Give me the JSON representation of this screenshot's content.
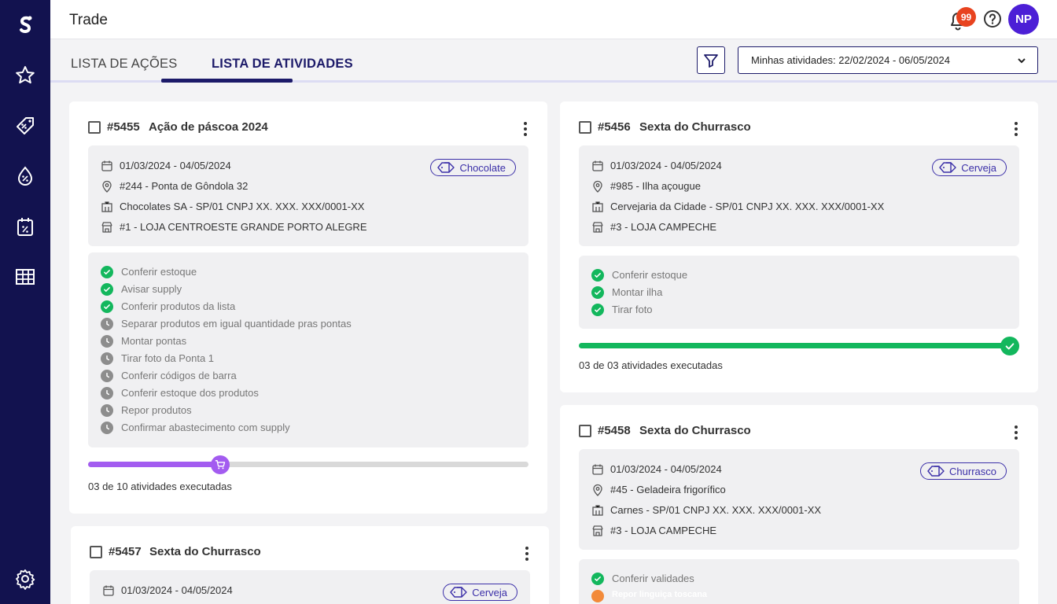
{
  "app": {
    "title": "Trade"
  },
  "header": {
    "notifications_count": "99",
    "avatar_initials": "NP"
  },
  "sidebar": {
    "icons": [
      "logo-icon",
      "star-icon",
      "tag-discount-icon",
      "drop-percent-icon",
      "calendar-percent-icon",
      "table-icon",
      "gear-icon"
    ]
  },
  "tabs": [
    {
      "label": "LISTA DE AÇÕES",
      "active": false
    },
    {
      "label": "LISTA DE ATIVIDADES",
      "active": true
    }
  ],
  "filter": {
    "date_range_label": "Minhas atividades: 22/02/2024 - 06/05/2024"
  },
  "colors": {
    "primary": "#1c1a69",
    "sidebar": "#12124f",
    "done": "#13b75d",
    "progress_purple": "#a35cf0",
    "warning": "#f28a3a",
    "badge": "#e8431f"
  },
  "cards": [
    {
      "id": "#5455",
      "name": "Ação de páscoa 2024",
      "tag": "Chocolate",
      "dates": "01/03/2024 - 04/05/2024",
      "location": "#244 - Ponta de Gôndola 32",
      "company": "Chocolates SA - SP/01 CNPJ XX. XXX. XXX/0001-XX",
      "store": "#1 - LOJA CENTROESTE GRANDE PORTO ALEGRE",
      "activities": [
        {
          "label": "Conferir estoque",
          "status": "done"
        },
        {
          "label": "Avisar supply",
          "status": "done"
        },
        {
          "label": "Conferir produtos da lista",
          "status": "done"
        },
        {
          "label": "Separar produtos em igual quantidade pras pontas",
          "status": "pending"
        },
        {
          "label": "Montar pontas",
          "status": "pending"
        },
        {
          "label": "Tirar foto da Ponta 1",
          "status": "pending"
        },
        {
          "label": "Conferir códigos de barra",
          "status": "pending"
        },
        {
          "label": "Conferir estoque dos produtos",
          "status": "pending"
        },
        {
          "label": "Repor produtos",
          "status": "pending"
        },
        {
          "label": "Confirmar abastecimento com supply",
          "status": "pending"
        }
      ],
      "progress": 0.3,
      "progress_text": "03 de 10 atividades executadas"
    },
    {
      "id": "#5456",
      "name": "Sexta do Churrasco",
      "tag": "Cerveja",
      "dates": "01/03/2024 - 04/05/2024",
      "location": "#985 - Ilha açougue",
      "company": "Cervejaria da Cidade - SP/01 CNPJ XX. XXX. XXX/0001-XX",
      "store": "#3 - LOJA CAMPECHE",
      "activities": [
        {
          "label": "Conferir estoque",
          "status": "done"
        },
        {
          "label": "Montar ilha",
          "status": "done"
        },
        {
          "label": "Tirar foto",
          "status": "done"
        }
      ],
      "progress": 1.0,
      "progress_text": "03 de 03 atividades executadas"
    },
    {
      "id": "#5457",
      "name": "Sexta do Churrasco",
      "tag": "Cerveja",
      "dates": "01/03/2024 - 04/05/2024"
    },
    {
      "id": "#5458",
      "name": "Sexta do Churrasco",
      "tag": "Churrasco",
      "dates": "01/03/2024 - 04/05/2024",
      "location": "#45 - Geladeira frigorífico",
      "company": "Carnes - SP/01 CNPJ XX. XXX. XXX/0001-XX",
      "store": "#3 - LOJA CAMPECHE",
      "activities": [
        {
          "label": "Conferir validades",
          "status": "done"
        },
        {
          "label": "Repor linguiça toscana",
          "status": "warning"
        }
      ]
    }
  ]
}
